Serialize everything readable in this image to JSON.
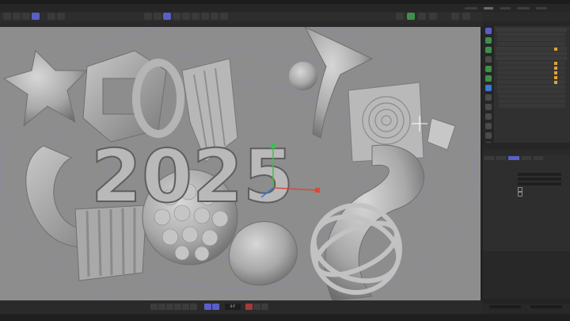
{
  "viewport": {
    "big_text": "2025"
  },
  "timeline": {
    "frame_label": "0 F"
  },
  "colors": {
    "accent": "#5a5fc8",
    "axis_x": "#d84a3a",
    "axis_y": "#3fbf4a",
    "axis_z": "#3a78d8",
    "viewport_bg": "#8d8d8d",
    "panel_bg": "#303030",
    "tag_orange": "#e0a23a",
    "tag_yellow": "#d7b44a"
  },
  "icons": {
    "toolbar": [
      "move-icon",
      "rotate-icon",
      "scale-icon",
      "select-icon",
      "undo-icon",
      "redo-icon",
      "render-icon",
      "render-settings-icon",
      "cube-icon",
      "pen-icon",
      "deformer-icon",
      "camera-icon",
      "light-icon",
      "tag-icon",
      "material-icon",
      "sphere-icon",
      "layers-icon",
      "gear-icon"
    ],
    "side": [
      "cube-icon",
      "sphere-icon",
      "spline-icon",
      "text-icon",
      "generator-icon",
      "deformer-icon",
      "field-icon",
      "effector-icon",
      "camera-icon",
      "light-icon",
      "tag-icon",
      "material-icon",
      "layer-icon",
      "python-icon"
    ]
  }
}
